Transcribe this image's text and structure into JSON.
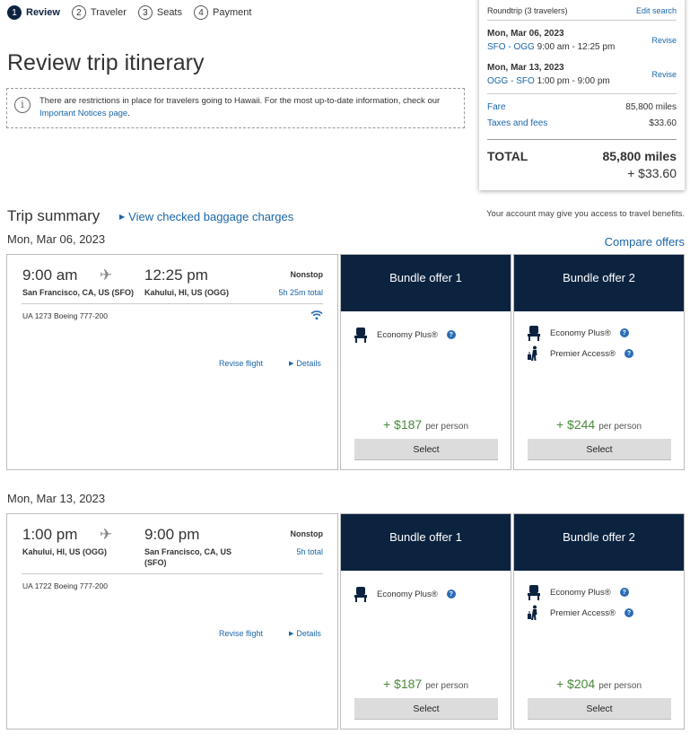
{
  "steps": [
    {
      "num": "1",
      "label": "Review",
      "active": true
    },
    {
      "num": "2",
      "label": "Traveler",
      "active": false
    },
    {
      "num": "3",
      "label": "Seats",
      "active": false
    },
    {
      "num": "4",
      "label": "Payment",
      "active": false
    }
  ],
  "page_title": "Review trip itinerary",
  "notice": {
    "text_before": "There are restrictions in place for travelers going to Hawaii. For the most up-to-date information, check our ",
    "link": "Important Notices page",
    "text_after": ".",
    "icon": "info-icon"
  },
  "summary": {
    "trip_type": "Roundtrip (3 travelers)",
    "edit_search": "Edit search",
    "segments": [
      {
        "date": "Mon, Mar 06, 2023",
        "route": "SFO - OGG",
        "times": "9:00 am - 12:25 pm",
        "revise": "Revise"
      },
      {
        "date": "Mon, Mar 13, 2023",
        "route": "OGG - SFO",
        "times": "1:00 pm - 9:00 pm",
        "revise": "Revise"
      }
    ],
    "fare_label": "Fare",
    "fare_value": "85,800 miles",
    "taxes_label": "Taxes and fees",
    "taxes_value": "$33.60",
    "total_label": "TOTAL",
    "total_miles": "85,800 miles",
    "total_cash": "+ $33.60"
  },
  "trip_summary": {
    "title": "Trip summary",
    "baggage_link": "View checked baggage charges",
    "benefits_note": "Your account may give you access to travel benefits.",
    "compare_offers": "Compare offers"
  },
  "flights": [
    {
      "date": "Mon, Mar 06, 2023",
      "depart_time": "9:00 am",
      "depart_city": "San Francisco, CA, US (SFO)",
      "arrive_time": "12:25 pm",
      "arrive_city": "Kahului, HI, US (OGG)",
      "stops": "Nonstop",
      "duration": "5h 25m total",
      "flight_info": "UA 1273  Boeing 777-200",
      "wifi": true,
      "revise": "Revise flight",
      "details": "Details",
      "bundles": [
        {
          "title": "Bundle offer 1",
          "features": [
            "Economy Plus®"
          ],
          "price": "+ $187",
          "per": "per person",
          "select": "Select"
        },
        {
          "title": "Bundle offer 2",
          "features": [
            "Economy Plus®",
            "Premier Access®"
          ],
          "price": "+ $244",
          "per": "per person",
          "select": "Select"
        }
      ]
    },
    {
      "date": "Mon, Mar 13, 2023",
      "depart_time": "1:00 pm",
      "depart_city": "Kahului, HI, US (OGG)",
      "arrive_time": "9:00 pm",
      "arrive_city": "San Francisco, CA, US (SFO)",
      "stops": "Nonstop",
      "duration": "5h total",
      "flight_info": "UA 1722  Boeing 777-200",
      "wifi": false,
      "revise": "Revise flight",
      "details": "Details",
      "bundles": [
        {
          "title": "Bundle offer 1",
          "features": [
            "Economy Plus®"
          ],
          "price": "+ $187",
          "per": "per person",
          "select": "Select"
        },
        {
          "title": "Bundle offer 2",
          "features": [
            "Economy Plus®",
            "Premier Access®"
          ],
          "price": "+ $204",
          "per": "per person",
          "select": "Select"
        }
      ]
    }
  ],
  "colors": {
    "navy": "#0c2340",
    "link": "#1a66a8",
    "price_green": "#4a8a3c",
    "help_blue": "#2a6db5"
  }
}
